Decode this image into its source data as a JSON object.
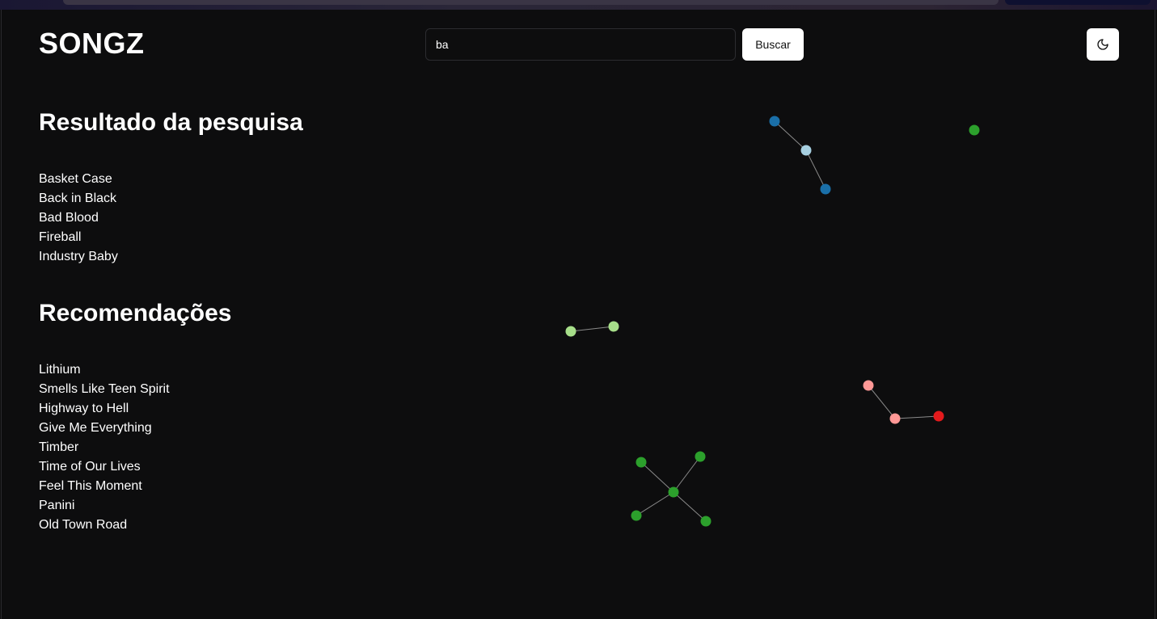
{
  "app": {
    "title": "SONGZ"
  },
  "search": {
    "value": "ba",
    "placeholder": "",
    "button_label": "Buscar"
  },
  "theme_toggle": {
    "icon": "moon-icon"
  },
  "results": {
    "title": "Resultado da pesquisa",
    "items": [
      "Basket Case",
      "Back in Black",
      "Bad Blood",
      "Fireball",
      "Industry Baby"
    ]
  },
  "recommendations": {
    "title": "Recomendações",
    "items": [
      "Lithium",
      "Smells Like Teen Spirit",
      "Highway to Hell",
      "Give Me Everything",
      "Timber",
      "Time of Our Lives",
      "Feel This Moment",
      "Panini",
      "Old Town Road"
    ]
  },
  "colors": {
    "background": "#0d0d0e",
    "text": "#ffffff",
    "node_dark_blue": "#1a6fa8",
    "node_light_blue": "#a6cfe0",
    "node_green": "#2ca02c",
    "node_light_green": "#a7df8a",
    "node_pink": "#ff9896",
    "node_red": "#e31a1c",
    "edge": "#8a8a8a"
  }
}
